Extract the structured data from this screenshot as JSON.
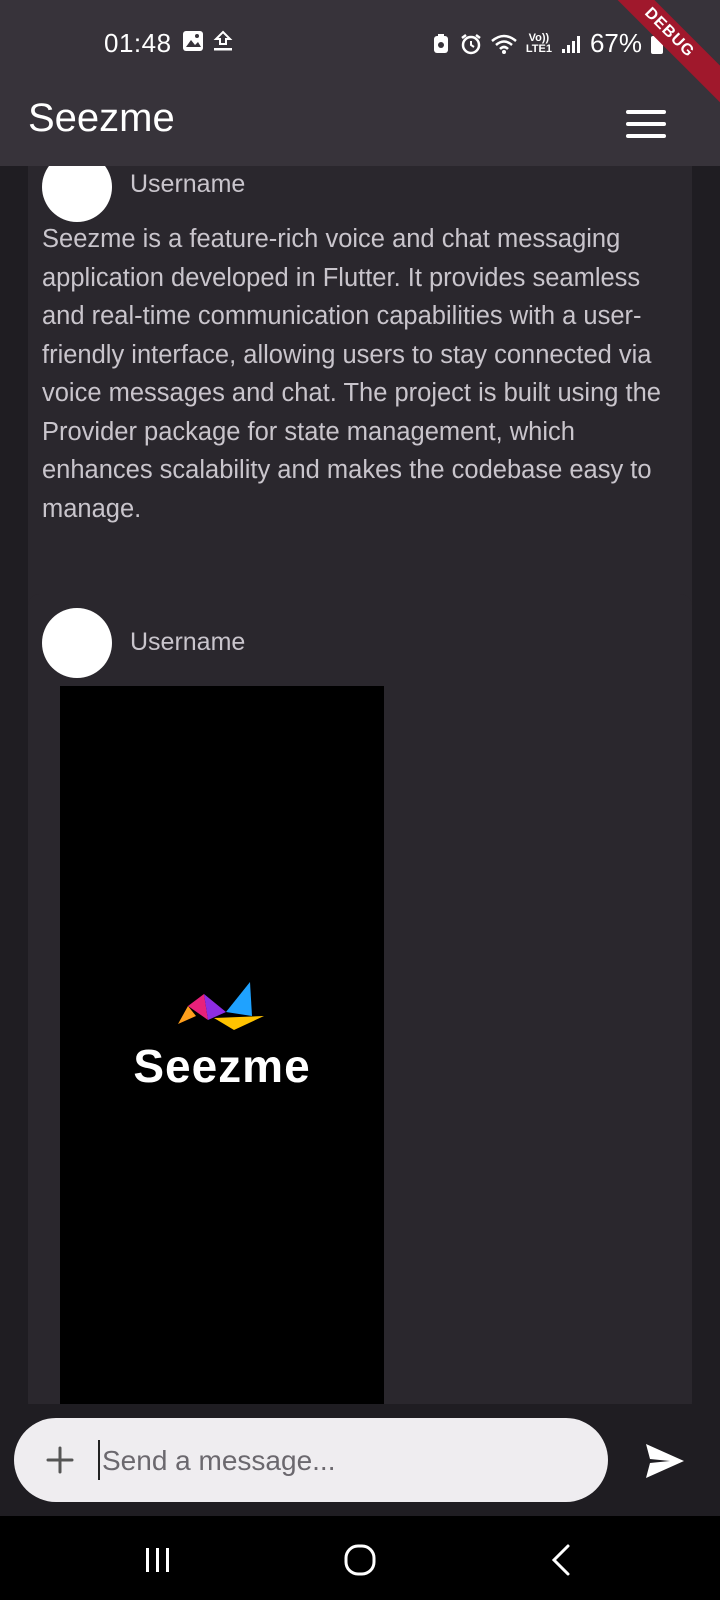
{
  "status_bar": {
    "time": "01:48",
    "left_icons": [
      "image-icon",
      "upload-icon"
    ],
    "right_icons": [
      "battery-saver-icon",
      "alarm-icon",
      "wifi-icon",
      "volte-icon",
      "signal-icon",
      "battery-icon"
    ],
    "volte_label_top": "Vo))",
    "volte_label_bottom": "LTE1",
    "battery_percent": "67%"
  },
  "debug_banner": "DEBUG",
  "app_bar": {
    "title": "Seezme",
    "menu_icon": "hamburger-menu-icon"
  },
  "posts": [
    {
      "username": "Username",
      "text": "Seezme is a feature-rich voice and chat messaging application developed in Flutter. It provides seamless and real-time communication capabilities with a user-friendly interface, allowing users to stay connected via voice messages and chat. The project is built using the Provider package for state management, which enhances scalability and makes the codebase easy to manage."
    },
    {
      "username": "Username",
      "image_logo_text": "Seezme"
    }
  ],
  "composer": {
    "placeholder": "Send a message...",
    "add_icon": "plus-icon",
    "send_icon": "send-icon"
  },
  "nav_bar": {
    "buttons": [
      "recent-apps-icon",
      "home-icon",
      "back-icon"
    ]
  },
  "colors": {
    "background": "#1f1d22",
    "app_bar": "#37333a",
    "card": "#2a272d",
    "composer": "#efedf0",
    "debug": "#a0182c"
  }
}
